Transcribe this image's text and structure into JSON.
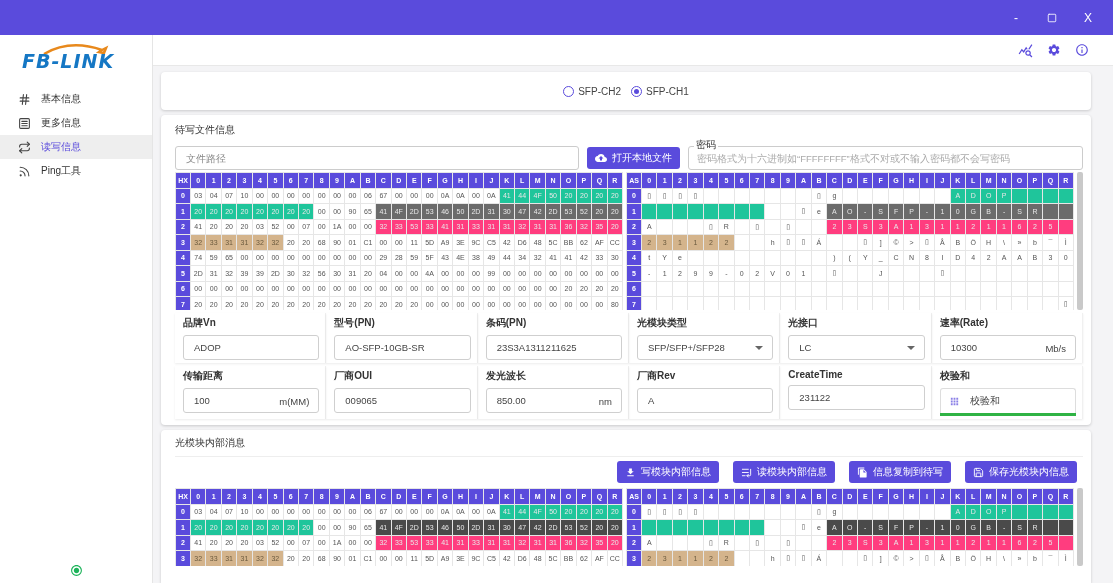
{
  "window": {
    "minimize": "-",
    "close": "X"
  },
  "logo": {
    "text": "FB-LINK"
  },
  "sidebar": {
    "items": [
      {
        "label": "基本信息",
        "kind": "hash",
        "selected": false
      },
      {
        "label": "更多信息",
        "kind": "list",
        "selected": false
      },
      {
        "label": "读写信息",
        "kind": "swap",
        "selected": true
      },
      {
        "label": "Ping工具",
        "kind": "ping",
        "selected": false
      }
    ],
    "connected": true
  },
  "channels": [
    {
      "label": "SFP-CH2",
      "selected": false
    },
    {
      "label": "SFP-CH1",
      "selected": true
    }
  ],
  "write_file": {
    "title": "待写文件信息",
    "path_placeholder": "文件路径",
    "open_button": "打开本地文件",
    "password": {
      "label": "密码",
      "placeholder": "密码格式为十六进制如“FFFFFFFF”格式不对或不输入密码都不会写密码"
    }
  },
  "grid": {
    "hex_corner": "HX",
    "ascii_corner": "AS",
    "hex_columns": [
      "0",
      "1",
      "2",
      "3",
      "4",
      "5",
      "6",
      "7",
      "8",
      "9",
      "A",
      "B",
      "C",
      "D",
      "E",
      "F",
      "G",
      "H",
      "I",
      "J",
      "K",
      "L",
      "M",
      "N",
      "O",
      "P",
      "Q",
      "R"
    ],
    "ascii_columns": [
      "0",
      "1",
      "2",
      "3",
      "4",
      "5",
      "6",
      "7",
      "8",
      "9",
      "A",
      "B",
      "C",
      "D",
      "E",
      "F",
      "G",
      "H",
      "I",
      "J",
      "K",
      "L",
      "M",
      "N",
      "O",
      "P",
      "Q",
      "R"
    ],
    "rows": [
      {
        "hex_label": "0",
        "ascii_label": "0",
        "hex": [
          "03",
          "04",
          "07",
          "10",
          "00",
          "00",
          "00",
          "00",
          "00",
          "00",
          "00",
          "06",
          "67",
          "00",
          "00",
          "00",
          "0A",
          "0A",
          "00",
          "0A",
          {
            "text": "41",
            "color": "#1fc59b"
          },
          {
            "text": "44",
            "color": "#1fc59b"
          },
          {
            "text": "4F",
            "color": "#1fc59b"
          },
          {
            "text": "50",
            "color": "#1fc59b"
          },
          {
            "text": "20",
            "color": "#1fc59b"
          },
          {
            "text": "20",
            "color": "#1fc59b"
          },
          {
            "text": "20",
            "color": "#1fc59b"
          },
          {
            "text": "20",
            "color": "#1fc59b"
          }
        ],
        "ascii": [
          "▯",
          "▯",
          "▯",
          "▯",
          {
            "kind": "blank"
          },
          {
            "kind": "blank"
          },
          {
            "kind": "blank"
          },
          {
            "kind": "blank"
          },
          {
            "kind": "blank"
          },
          {
            "kind": "blank"
          },
          {
            "kind": "blank"
          },
          "▯",
          "g",
          {
            "kind": "blank"
          },
          {
            "kind": "blank"
          },
          {
            "kind": "blank"
          },
          {
            "kind": "blank"
          },
          {
            "kind": "blank"
          },
          {
            "kind": "blank"
          },
          {
            "kind": "blank"
          },
          {
            "text": "A",
            "color": "#1fc59b"
          },
          {
            "text": "D",
            "color": "#1fc59b"
          },
          {
            "text": "O",
            "color": "#1fc59b"
          },
          {
            "text": "P",
            "color": "#1fc59b"
          },
          {
            "color": "#1fc59b"
          },
          {
            "color": "#1fc59b"
          },
          {
            "color": "#1fc59b"
          },
          {
            "color": "#1fc59b"
          }
        ]
      },
      {
        "hex_label": "1",
        "ascii_label": "1",
        "hex": [
          {
            "text": "20",
            "color": "#1fc59b"
          },
          {
            "text": "20",
            "color": "#1fc59b"
          },
          {
            "text": "20",
            "color": "#1fc59b"
          },
          {
            "text": "20",
            "color": "#1fc59b"
          },
          {
            "text": "20",
            "color": "#1fc59b"
          },
          {
            "text": "20",
            "color": "#1fc59b"
          },
          {
            "text": "20",
            "color": "#1fc59b"
          },
          {
            "text": "20",
            "color": "#1fc59b"
          },
          "00",
          "00",
          "90",
          "65",
          {
            "text": "41",
            "color": "#6b6b6b"
          },
          {
            "text": "4F",
            "color": "#6b6b6b"
          },
          {
            "text": "2D",
            "color": "#6b6b6b"
          },
          {
            "text": "53",
            "color": "#6b6b6b"
          },
          {
            "text": "46",
            "color": "#6b6b6b"
          },
          {
            "text": "50",
            "color": "#6b6b6b"
          },
          {
            "text": "2D",
            "color": "#6b6b6b"
          },
          {
            "text": "31",
            "color": "#6b6b6b"
          },
          {
            "text": "30",
            "color": "#6b6b6b"
          },
          {
            "text": "47",
            "color": "#6b6b6b"
          },
          {
            "text": "42",
            "color": "#6b6b6b"
          },
          {
            "text": "2D",
            "color": "#6b6b6b"
          },
          {
            "text": "53",
            "color": "#6b6b6b"
          },
          {
            "text": "52",
            "color": "#6b6b6b"
          },
          {
            "text": "20",
            "color": "#6b6b6b"
          },
          {
            "text": "20",
            "color": "#6b6b6b"
          }
        ],
        "ascii": [
          {
            "color": "#1fc59b"
          },
          {
            "color": "#1fc59b"
          },
          {
            "color": "#1fc59b"
          },
          {
            "color": "#1fc59b"
          },
          {
            "color": "#1fc59b"
          },
          {
            "color": "#1fc59b"
          },
          {
            "color": "#1fc59b"
          },
          {
            "color": "#1fc59b"
          },
          {
            "kind": "blank"
          },
          {
            "kind": "blank"
          },
          "▯",
          "e",
          {
            "text": "A",
            "color": "#6b6b6b"
          },
          {
            "text": "O",
            "color": "#6b6b6b"
          },
          {
            "text": "-",
            "color": "#6b6b6b"
          },
          {
            "text": "S",
            "color": "#6b6b6b"
          },
          {
            "text": "F",
            "color": "#6b6b6b"
          },
          {
            "text": "P",
            "color": "#6b6b6b"
          },
          {
            "text": "-",
            "color": "#6b6b6b"
          },
          {
            "text": "1",
            "color": "#6b6b6b"
          },
          {
            "text": "0",
            "color": "#6b6b6b"
          },
          {
            "text": "G",
            "color": "#6b6b6b"
          },
          {
            "text": "B",
            "color": "#6b6b6b"
          },
          {
            "text": "-",
            "color": "#6b6b6b"
          },
          {
            "text": "S",
            "color": "#6b6b6b"
          },
          {
            "text": "R",
            "color": "#6b6b6b"
          },
          {
            "color": "#6b6b6b"
          },
          {
            "color": "#6b6b6b"
          }
        ]
      },
      {
        "hex_label": "2",
        "ascii_label": "2",
        "hex": [
          "41",
          "20",
          "20",
          "20",
          "03",
          "52",
          "00",
          "07",
          "00",
          "1A",
          "00",
          "00",
          {
            "text": "32",
            "color": "#ff3d7f"
          },
          {
            "text": "33",
            "color": "#ff3d7f"
          },
          {
            "text": "53",
            "color": "#ff3d7f"
          },
          {
            "text": "33",
            "color": "#ff3d7f"
          },
          {
            "text": "41",
            "color": "#ff3d7f"
          },
          {
            "text": "31",
            "color": "#ff3d7f"
          },
          {
            "text": "33",
            "color": "#ff3d7f"
          },
          {
            "text": "31",
            "color": "#ff3d7f"
          },
          {
            "text": "31",
            "color": "#ff3d7f"
          },
          {
            "text": "32",
            "color": "#ff3d7f"
          },
          {
            "text": "31",
            "color": "#ff3d7f"
          },
          {
            "text": "31",
            "color": "#ff3d7f"
          },
          {
            "text": "36",
            "color": "#ff3d7f"
          },
          {
            "text": "32",
            "color": "#ff3d7f"
          },
          {
            "text": "35",
            "color": "#ff3d7f"
          },
          {
            "text": "20",
            "color": "#ff3d7f"
          }
        ],
        "ascii": [
          "A",
          {
            "kind": "blank"
          },
          {
            "kind": "blank"
          },
          {
            "kind": "blank"
          },
          "▯",
          "R",
          {
            "kind": "blank"
          },
          "▯",
          {
            "kind": "blank"
          },
          "▯",
          {
            "kind": "blank"
          },
          {
            "kind": "blank"
          },
          {
            "text": "2",
            "color": "#ff3d7f"
          },
          {
            "text": "3",
            "color": "#ff3d7f"
          },
          {
            "text": "S",
            "color": "#ff3d7f"
          },
          {
            "text": "3",
            "color": "#ff3d7f"
          },
          {
            "text": "A",
            "color": "#ff3d7f"
          },
          {
            "text": "1",
            "color": "#ff3d7f"
          },
          {
            "text": "3",
            "color": "#ff3d7f"
          },
          {
            "text": "1",
            "color": "#ff3d7f"
          },
          {
            "text": "1",
            "color": "#ff3d7f"
          },
          {
            "text": "2",
            "color": "#ff3d7f"
          },
          {
            "text": "1",
            "color": "#ff3d7f"
          },
          {
            "text": "1",
            "color": "#ff3d7f"
          },
          {
            "text": "6",
            "color": "#ff3d7f"
          },
          {
            "text": "2",
            "color": "#ff3d7f"
          },
          {
            "text": "5",
            "color": "#ff3d7f"
          },
          {
            "color": "#ff3d7f"
          }
        ]
      },
      {
        "hex_label": "3",
        "ascii_label": "3",
        "hex": [
          {
            "text": "32",
            "color": "#d4b48c"
          },
          {
            "text": "33",
            "color": "#d4b48c"
          },
          {
            "text": "31",
            "color": "#d4b48c"
          },
          {
            "text": "31",
            "color": "#d4b48c"
          },
          {
            "text": "32",
            "color": "#d4b48c"
          },
          {
            "text": "32",
            "color": "#d4b48c"
          },
          "20",
          "20",
          "68",
          "90",
          "01",
          "C1",
          "00",
          "00",
          "11",
          "5D",
          "A9",
          "3E",
          "9C",
          "C5",
          "42",
          "D6",
          "48",
          "5C",
          "BB",
          "62",
          "AF",
          "CC"
        ],
        "ascii": [
          {
            "text": "2",
            "color": "#d4b48c"
          },
          {
            "text": "3",
            "color": "#d4b48c"
          },
          {
            "text": "1",
            "color": "#d4b48c"
          },
          {
            "text": "1",
            "color": "#d4b48c"
          },
          {
            "text": "2",
            "color": "#d4b48c"
          },
          {
            "text": "2",
            "color": "#d4b48c"
          },
          {
            "kind": "blank"
          },
          {
            "kind": "blank"
          },
          "h",
          "▯",
          "▯",
          "Á",
          {
            "kind": "blank"
          },
          {
            "kind": "blank"
          },
          "▯",
          "]",
          "©",
          ">",
          "▯",
          "Å",
          "B",
          "Ö",
          "H",
          "\\",
          "»",
          "b",
          "¯",
          "Ì"
        ]
      },
      {
        "hex_label": "4",
        "ascii_label": "4",
        "hex": [
          "74",
          "59",
          "65",
          "00",
          "00",
          "00",
          "00",
          "00",
          "00",
          "00",
          "00",
          "00",
          "29",
          "28",
          "59",
          "5F",
          "43",
          "4E",
          "38",
          "49",
          "44",
          "34",
          "32",
          "41",
          "41",
          "42",
          "33",
          "30"
        ],
        "ascii": [
          "t",
          "Y",
          "e",
          {
            "kind": "blank"
          },
          {
            "kind": "blank"
          },
          {
            "kind": "blank"
          },
          {
            "kind": "blank"
          },
          {
            "kind": "blank"
          },
          {
            "kind": "blank"
          },
          {
            "kind": "blank"
          },
          {
            "kind": "blank"
          },
          {
            "kind": "blank"
          },
          ")",
          "(",
          "Y",
          "_",
          "C",
          "N",
          "8",
          "I",
          "D",
          "4",
          "2",
          "A",
          "A",
          "B",
          "3",
          "0"
        ]
      },
      {
        "hex_label": "5",
        "ascii_label": "5",
        "hex": [
          "2D",
          "31",
          "32",
          "39",
          "39",
          "2D",
          "30",
          "32",
          "56",
          "30",
          "31",
          "20",
          "04",
          "00",
          "00",
          "4A",
          "00",
          "00",
          "00",
          "99",
          "00",
          "00",
          "00",
          "00",
          "00",
          "00",
          "00",
          "00"
        ],
        "ascii": [
          "-",
          "1",
          "2",
          "9",
          "9",
          "-",
          "0",
          "2",
          "V",
          "0",
          "1",
          {
            "kind": "blank"
          },
          "▯",
          {
            "kind": "blank"
          },
          {
            "kind": "blank"
          },
          "J",
          {
            "kind": "blank"
          },
          {
            "kind": "blank"
          },
          {
            "kind": "blank"
          },
          "▯",
          {
            "kind": "blank"
          },
          {
            "kind": "blank"
          },
          {
            "kind": "blank"
          },
          {
            "kind": "blank"
          },
          {
            "kind": "blank"
          },
          {
            "kind": "blank"
          },
          {
            "kind": "blank"
          },
          {
            "kind": "blank"
          }
        ]
      },
      {
        "hex_label": "6",
        "ascii_label": "6",
        "hex": [
          "00",
          "00",
          "00",
          "00",
          "00",
          "00",
          "00",
          "00",
          "00",
          "00",
          "00",
          "00",
          "00",
          "00",
          "00",
          "00",
          "00",
          "00",
          "00",
          "00",
          "00",
          "00",
          "00",
          "00",
          "20",
          "20",
          "20",
          "20"
        ],
        "ascii": [
          {
            "kind": "blank"
          },
          {
            "kind": "blank"
          },
          {
            "kind": "blank"
          },
          {
            "kind": "blank"
          },
          {
            "kind": "blank"
          },
          {
            "kind": "blank"
          },
          {
            "kind": "blank"
          },
          {
            "kind": "blank"
          },
          {
            "kind": "blank"
          },
          {
            "kind": "blank"
          },
          {
            "kind": "blank"
          },
          {
            "kind": "blank"
          },
          {
            "kind": "blank"
          },
          {
            "kind": "blank"
          },
          {
            "kind": "blank"
          },
          {
            "kind": "blank"
          },
          {
            "kind": "blank"
          },
          {
            "kind": "blank"
          },
          {
            "kind": "blank"
          },
          {
            "kind": "blank"
          },
          {
            "kind": "blank"
          },
          {
            "kind": "blank"
          },
          {
            "kind": "blank"
          },
          {
            "kind": "blank"
          },
          {
            "kind": "blank"
          },
          {
            "kind": "blank"
          },
          {
            "kind": "blank"
          },
          {
            "kind": "blank"
          }
        ]
      },
      {
        "hex_label": "7",
        "ascii_label": "7",
        "hex": [
          "20",
          "20",
          "20",
          "20",
          "20",
          "20",
          "20",
          "20",
          "20",
          "20",
          "20",
          "20",
          "20",
          "20",
          "20",
          "00",
          "00",
          "00",
          "00",
          "00",
          "00",
          "00",
          "00",
          "00",
          "00",
          "00",
          "00",
          "80"
        ],
        "ascii": [
          {
            "kind": "blank"
          },
          {
            "kind": "blank"
          },
          {
            "kind": "blank"
          },
          {
            "kind": "blank"
          },
          {
            "kind": "blank"
          },
          {
            "kind": "blank"
          },
          {
            "kind": "blank"
          },
          {
            "kind": "blank"
          },
          {
            "kind": "blank"
          },
          {
            "kind": "blank"
          },
          {
            "kind": "blank"
          },
          {
            "kind": "blank"
          },
          {
            "kind": "blank"
          },
          {
            "kind": "blank"
          },
          {
            "kind": "blank"
          },
          {
            "kind": "blank"
          },
          {
            "kind": "blank"
          },
          {
            "kind": "blank"
          },
          {
            "kind": "blank"
          },
          {
            "kind": "blank"
          },
          {
            "kind": "blank"
          },
          {
            "kind": "blank"
          },
          {
            "kind": "blank"
          },
          {
            "kind": "blank"
          },
          {
            "kind": "blank"
          },
          {
            "kind": "blank"
          },
          {
            "kind": "blank"
          },
          "▯"
        ]
      }
    ]
  },
  "fields": [
    {
      "label": "品牌Vn",
      "kind": "text",
      "value": "ADOP"
    },
    {
      "label": "型号(PN)",
      "kind": "text",
      "value": "AO-SFP-10GB-SR"
    },
    {
      "label": "条码(PN)",
      "kind": "text",
      "value": "23S3A1311211625"
    },
    {
      "label": "光模块类型",
      "kind": "select",
      "value": "SFP/SFP+/SFP28"
    },
    {
      "label": "光接口",
      "kind": "select",
      "value": "LC"
    },
    {
      "label": "速率(Rate)",
      "kind": "unit",
      "value": "10300",
      "unit": "Mb/s"
    },
    {
      "label": "传输距离",
      "kind": "unit",
      "value": "100",
      "unit": "m(MM)"
    },
    {
      "label": "厂商OUI",
      "kind": "text",
      "value": "009065"
    },
    {
      "label": "发光波长",
      "kind": "unit",
      "value": "850.00",
      "unit": "nm"
    },
    {
      "label": "厂商Rev",
      "kind": "text",
      "value": "A"
    },
    {
      "label": "CreateTime",
      "kind": "text",
      "value": "231122"
    },
    {
      "label": "校验和",
      "kind": "checksum",
      "value": "校验和",
      "level": 1
    }
  ],
  "module": {
    "title": "光模块内部消息",
    "buttons": [
      {
        "label": "写模块内部信息",
        "kind": "download"
      },
      {
        "label": "读模块内部信息",
        "kind": "read"
      },
      {
        "label": "信息复制到待写",
        "kind": "copy"
      },
      {
        "label": "保存光模块内信息",
        "kind": "save"
      }
    ],
    "grid": {
      "hex_corner": "HX",
      "ascii_corner": "AS",
      "hex_columns": [
        "0",
        "1",
        "2",
        "3",
        "4",
        "5",
        "6",
        "7",
        "8",
        "9",
        "A",
        "B",
        "C",
        "D",
        "E",
        "F",
        "G",
        "H",
        "I",
        "J",
        "K",
        "L",
        "M",
        "N",
        "O",
        "P",
        "Q",
        "R"
      ],
      "ascii_columns": [
        "0",
        "1",
        "2",
        "3",
        "4",
        "5",
        "6",
        "7",
        "8",
        "9",
        "A",
        "B",
        "C",
        "D",
        "E",
        "F",
        "G",
        "H",
        "I",
        "J",
        "K",
        "L",
        "M",
        "N",
        "O",
        "P",
        "Q",
        "R"
      ],
      "rows": [
        {
          "hex_label": "0",
          "ascii_label": "0",
          "hex": [
            "03",
            "04",
            "07",
            "10",
            "00",
            "00",
            "00",
            "00",
            "00",
            "00",
            "00",
            "06",
            "67",
            "00",
            "00",
            "00",
            "0A",
            "0A",
            "00",
            "0A",
            {
              "text": "41",
              "color": "#1fc59b"
            },
            {
              "text": "44",
              "color": "#1fc59b"
            },
            {
              "text": "4F",
              "color": "#1fc59b"
            },
            {
              "text": "50",
              "color": "#1fc59b"
            },
            {
              "text": "20",
              "color": "#1fc59b"
            },
            {
              "text": "20",
              "color": "#1fc59b"
            },
            {
              "text": "20",
              "color": "#1fc59b"
            },
            {
              "text": "20",
              "color": "#1fc59b"
            }
          ],
          "ascii": [
            "▯",
            "▯",
            "▯",
            "▯",
            {
              "kind": "blank"
            },
            {
              "kind": "blank"
            },
            {
              "kind": "blank"
            },
            {
              "kind": "blank"
            },
            {
              "kind": "blank"
            },
            {
              "kind": "blank"
            },
            {
              "kind": "blank"
            },
            "▯",
            "g",
            {
              "kind": "blank"
            },
            {
              "kind": "blank"
            },
            {
              "kind": "blank"
            },
            {
              "kind": "blank"
            },
            {
              "kind": "blank"
            },
            {
              "kind": "blank"
            },
            {
              "kind": "blank"
            },
            {
              "text": "A",
              "color": "#1fc59b"
            },
            {
              "text": "D",
              "color": "#1fc59b"
            },
            {
              "text": "O",
              "color": "#1fc59b"
            },
            {
              "text": "P",
              "color": "#1fc59b"
            },
            {
              "color": "#1fc59b"
            },
            {
              "color": "#1fc59b"
            },
            {
              "color": "#1fc59b"
            },
            {
              "color": "#1fc59b"
            }
          ]
        },
        {
          "hex_label": "1",
          "ascii_label": "1",
          "hex": [
            {
              "text": "20",
              "color": "#1fc59b"
            },
            {
              "text": "20",
              "color": "#1fc59b"
            },
            {
              "text": "20",
              "color": "#1fc59b"
            },
            {
              "text": "20",
              "color": "#1fc59b"
            },
            {
              "text": "20",
              "color": "#1fc59b"
            },
            {
              "text": "20",
              "color": "#1fc59b"
            },
            {
              "text": "20",
              "color": "#1fc59b"
            },
            {
              "text": "20",
              "color": "#1fc59b"
            },
            "00",
            "00",
            "90",
            "65",
            {
              "text": "41",
              "color": "#4a4a4a"
            },
            {
              "text": "4F",
              "color": "#4a4a4a"
            },
            {
              "text": "2D",
              "color": "#4a4a4a"
            },
            {
              "text": "53",
              "color": "#4a4a4a"
            },
            {
              "text": "46",
              "color": "#4a4a4a"
            },
            {
              "text": "50",
              "color": "#4a4a4a"
            },
            {
              "text": "2D",
              "color": "#4a4a4a"
            },
            {
              "text": "31",
              "color": "#4a4a4a"
            },
            {
              "text": "30",
              "color": "#4a4a4a"
            },
            {
              "text": "47",
              "color": "#4a4a4a"
            },
            {
              "text": "42",
              "color": "#4a4a4a"
            },
            {
              "text": "2D",
              "color": "#4a4a4a"
            },
            {
              "text": "53",
              "color": "#4a4a4a"
            },
            {
              "text": "52",
              "color": "#4a4a4a"
            },
            {
              "text": "20",
              "color": "#4a4a4a"
            },
            {
              "text": "20",
              "color": "#4a4a4a"
            }
          ],
          "ascii": [
            {
              "color": "#1fc59b"
            },
            {
              "color": "#1fc59b"
            },
            {
              "color": "#1fc59b"
            },
            {
              "color": "#1fc59b"
            },
            {
              "color": "#1fc59b"
            },
            {
              "color": "#1fc59b"
            },
            {
              "color": "#1fc59b"
            },
            {
              "color": "#1fc59b"
            },
            {
              "kind": "blank"
            },
            {
              "kind": "blank"
            },
            "▯",
            "e",
            {
              "text": "A",
              "color": "#4a4a4a"
            },
            {
              "text": "O",
              "color": "#4a4a4a"
            },
            {
              "text": "-",
              "color": "#4a4a4a"
            },
            {
              "text": "S",
              "color": "#4a4a4a"
            },
            {
              "text": "F",
              "color": "#4a4a4a"
            },
            {
              "text": "P",
              "color": "#4a4a4a"
            },
            {
              "text": "-",
              "color": "#4a4a4a"
            },
            {
              "text": "1",
              "color": "#4a4a4a"
            },
            {
              "text": "0",
              "color": "#4a4a4a"
            },
            {
              "text": "G",
              "color": "#4a4a4a"
            },
            {
              "text": "B",
              "color": "#4a4a4a"
            },
            {
              "text": "-",
              "color": "#4a4a4a"
            },
            {
              "text": "S",
              "color": "#4a4a4a"
            },
            {
              "text": "R",
              "color": "#4a4a4a"
            },
            {
              "color": "#4a4a4a"
            },
            {
              "color": "#4a4a4a"
            }
          ]
        },
        {
          "hex_label": "2",
          "ascii_label": "2",
          "hex": [
            "41",
            "20",
            "20",
            "20",
            "03",
            "52",
            "00",
            "07",
            "00",
            "1A",
            "00",
            "00",
            {
              "text": "32",
              "color": "#ff3d7f"
            },
            {
              "text": "33",
              "color": "#ff3d7f"
            },
            {
              "text": "53",
              "color": "#ff3d7f"
            },
            {
              "text": "33",
              "color": "#ff3d7f"
            },
            {
              "text": "41",
              "color": "#ff3d7f"
            },
            {
              "text": "31",
              "color": "#ff3d7f"
            },
            {
              "text": "33",
              "color": "#ff3d7f"
            },
            {
              "text": "31",
              "color": "#ff3d7f"
            },
            {
              "text": "31",
              "color": "#ff3d7f"
            },
            {
              "text": "32",
              "color": "#ff3d7f"
            },
            {
              "text": "31",
              "color": "#ff3d7f"
            },
            {
              "text": "31",
              "color": "#ff3d7f"
            },
            {
              "text": "36",
              "color": "#ff3d7f"
            },
            {
              "text": "32",
              "color": "#ff3d7f"
            },
            {
              "text": "35",
              "color": "#ff3d7f"
            },
            {
              "text": "20",
              "color": "#ff3d7f"
            }
          ],
          "ascii": [
            "A",
            {
              "kind": "blank"
            },
            {
              "kind": "blank"
            },
            {
              "kind": "blank"
            },
            "▯",
            "R",
            {
              "kind": "blank"
            },
            "▯",
            {
              "kind": "blank"
            },
            "▯",
            {
              "kind": "blank"
            },
            {
              "kind": "blank"
            },
            {
              "text": "2",
              "color": "#ff3d7f"
            },
            {
              "text": "3",
              "color": "#ff3d7f"
            },
            {
              "text": "S",
              "color": "#ff3d7f"
            },
            {
              "text": "3",
              "color": "#ff3d7f"
            },
            {
              "text": "A",
              "color": "#ff3d7f"
            },
            {
              "text": "1",
              "color": "#ff3d7f"
            },
            {
              "text": "3",
              "color": "#ff3d7f"
            },
            {
              "text": "1",
              "color": "#ff3d7f"
            },
            {
              "text": "1",
              "color": "#ff3d7f"
            },
            {
              "text": "2",
              "color": "#ff3d7f"
            },
            {
              "text": "1",
              "color": "#ff3d7f"
            },
            {
              "text": "1",
              "color": "#ff3d7f"
            },
            {
              "text": "6",
              "color": "#ff3d7f"
            },
            {
              "text": "2",
              "color": "#ff3d7f"
            },
            {
              "text": "5",
              "color": "#ff3d7f"
            },
            {
              "color": "#ff3d7f"
            }
          ]
        },
        {
          "hex_label": "3",
          "ascii_label": "3",
          "hex": [
            {
              "text": "32",
              "color": "#d4b48c"
            },
            {
              "text": "33",
              "color": "#d4b48c"
            },
            {
              "text": "31",
              "color": "#d4b48c"
            },
            {
              "text": "31",
              "color": "#d4b48c"
            },
            {
              "text": "32",
              "color": "#d4b48c"
            },
            {
              "text": "32",
              "color": "#d4b48c"
            },
            "20",
            "20",
            "68",
            "90",
            "01",
            "C1",
            "00",
            "00",
            "11",
            "5D",
            "A9",
            "3E",
            "9C",
            "C5",
            "42",
            "D6",
            "48",
            "5C",
            "BB",
            "62",
            "AF",
            "CC"
          ],
          "ascii": [
            {
              "text": "2",
              "color": "#d4b48c"
            },
            {
              "text": "3",
              "color": "#d4b48c"
            },
            {
              "text": "1",
              "color": "#d4b48c"
            },
            {
              "text": "1",
              "color": "#d4b48c"
            },
            {
              "text": "2",
              "color": "#d4b48c"
            },
            {
              "text": "2",
              "color": "#d4b48c"
            },
            {
              "kind": "blank"
            },
            {
              "kind": "blank"
            },
            "h",
            "▯",
            "▯",
            "Á",
            {
              "kind": "blank"
            },
            {
              "kind": "blank"
            },
            "▯",
            "]",
            "©",
            ">",
            "▯",
            "Å",
            "B",
            "Ö",
            "H",
            "\\",
            "»",
            "b",
            "¯",
            "Ì"
          ]
        }
      ]
    }
  }
}
